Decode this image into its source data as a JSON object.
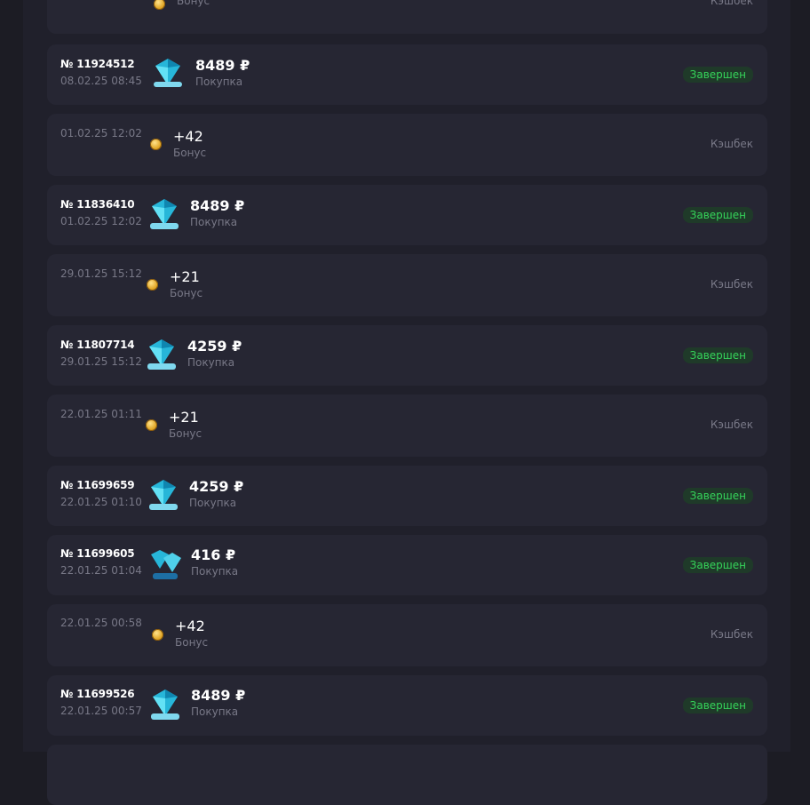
{
  "currency": "₽",
  "transactions": [
    {
      "kind": "bonus",
      "amount": "",
      "type": "Бонус",
      "status": "Кэшбек",
      "date": ""
    },
    {
      "kind": "purchase",
      "order": "№ 11924512",
      "date": "08.02.25 08:45",
      "amount": "8489 ₽",
      "type": "Покупка",
      "status": "Завершен"
    },
    {
      "kind": "bonus",
      "date": "01.02.25 12:02",
      "amount": "+42",
      "type": "Бонус",
      "status": "Кэшбек"
    },
    {
      "kind": "purchase",
      "order": "№ 11836410",
      "date": "01.02.25 12:02",
      "amount": "8489 ₽",
      "type": "Покупка",
      "status": "Завершен"
    },
    {
      "kind": "bonus",
      "date": "29.01.25 15:12",
      "amount": "+21",
      "type": "Бонус",
      "status": "Кэшбек"
    },
    {
      "kind": "purchase",
      "order": "№ 11807714",
      "date": "29.01.25 15:12",
      "amount": "4259 ₽",
      "type": "Покупка",
      "status": "Завершен"
    },
    {
      "kind": "bonus",
      "date": "22.01.25 01:11",
      "amount": "+21",
      "type": "Бонус",
      "status": "Кэшбек"
    },
    {
      "kind": "purchase",
      "order": "№ 11699659",
      "date": "22.01.25 01:10",
      "amount": "4259 ₽",
      "type": "Покупка",
      "status": "Завершен"
    },
    {
      "kind": "purchase",
      "order": "№ 11699605",
      "date": "22.01.25 01:04",
      "amount": "416 ₽",
      "type": "Покупка",
      "status": "Завершен"
    },
    {
      "kind": "bonus",
      "date": "22.01.25 00:58",
      "amount": "+42",
      "type": "Бонус",
      "status": "Кэшбек"
    },
    {
      "kind": "purchase",
      "order": "№ 11699526",
      "date": "22.01.25 00:57",
      "amount": "8489 ₽",
      "type": "Покупка",
      "status": "Завершен"
    }
  ],
  "icons": {
    "purchase": "diamond-pack-icon",
    "bonus": "coin-icon"
  },
  "colors": {
    "status_done": "#35d45a",
    "status_done_bg": "#1f3a29",
    "muted": "#787887",
    "card": "#262633"
  }
}
